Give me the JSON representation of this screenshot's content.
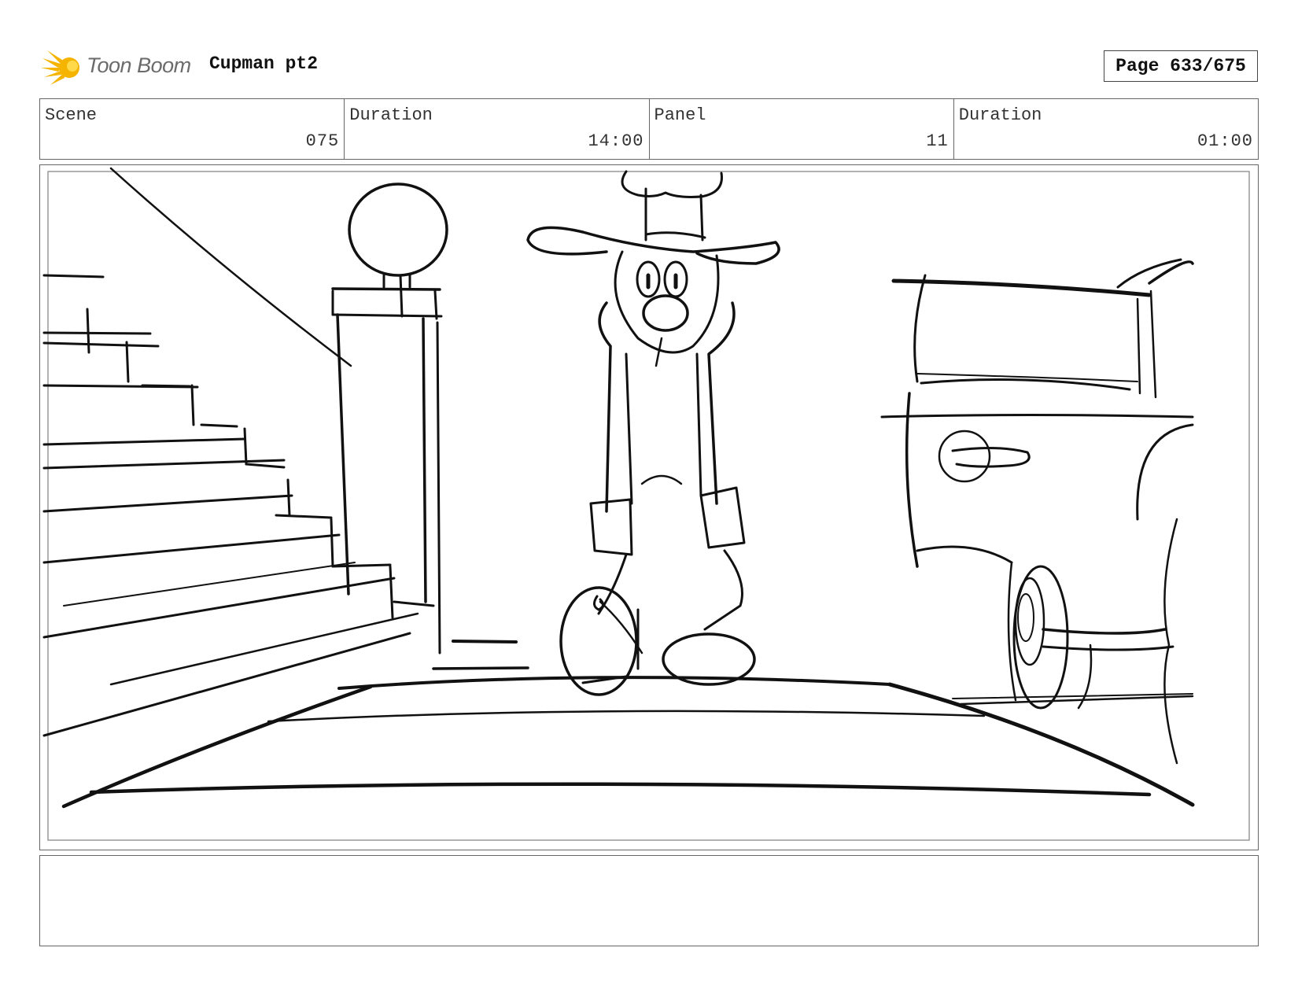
{
  "header": {
    "logo_text": "Toon Boom",
    "project_title": "Cupman pt2",
    "page_label": "Page 633/675"
  },
  "info": {
    "scene_label": "Scene",
    "scene_value": "075",
    "scene_duration_label": "Duration",
    "scene_duration_value": "14:00",
    "panel_label": "Panel",
    "panel_value": "11",
    "panel_duration_label": "Duration",
    "panel_duration_value": "01:00"
  },
  "notes": {
    "text": ""
  },
  "colors": {
    "logo_burst": "#f5b400",
    "logo_text": "#6b6b6b",
    "border": "#666666",
    "sketch_line": "#111111"
  }
}
